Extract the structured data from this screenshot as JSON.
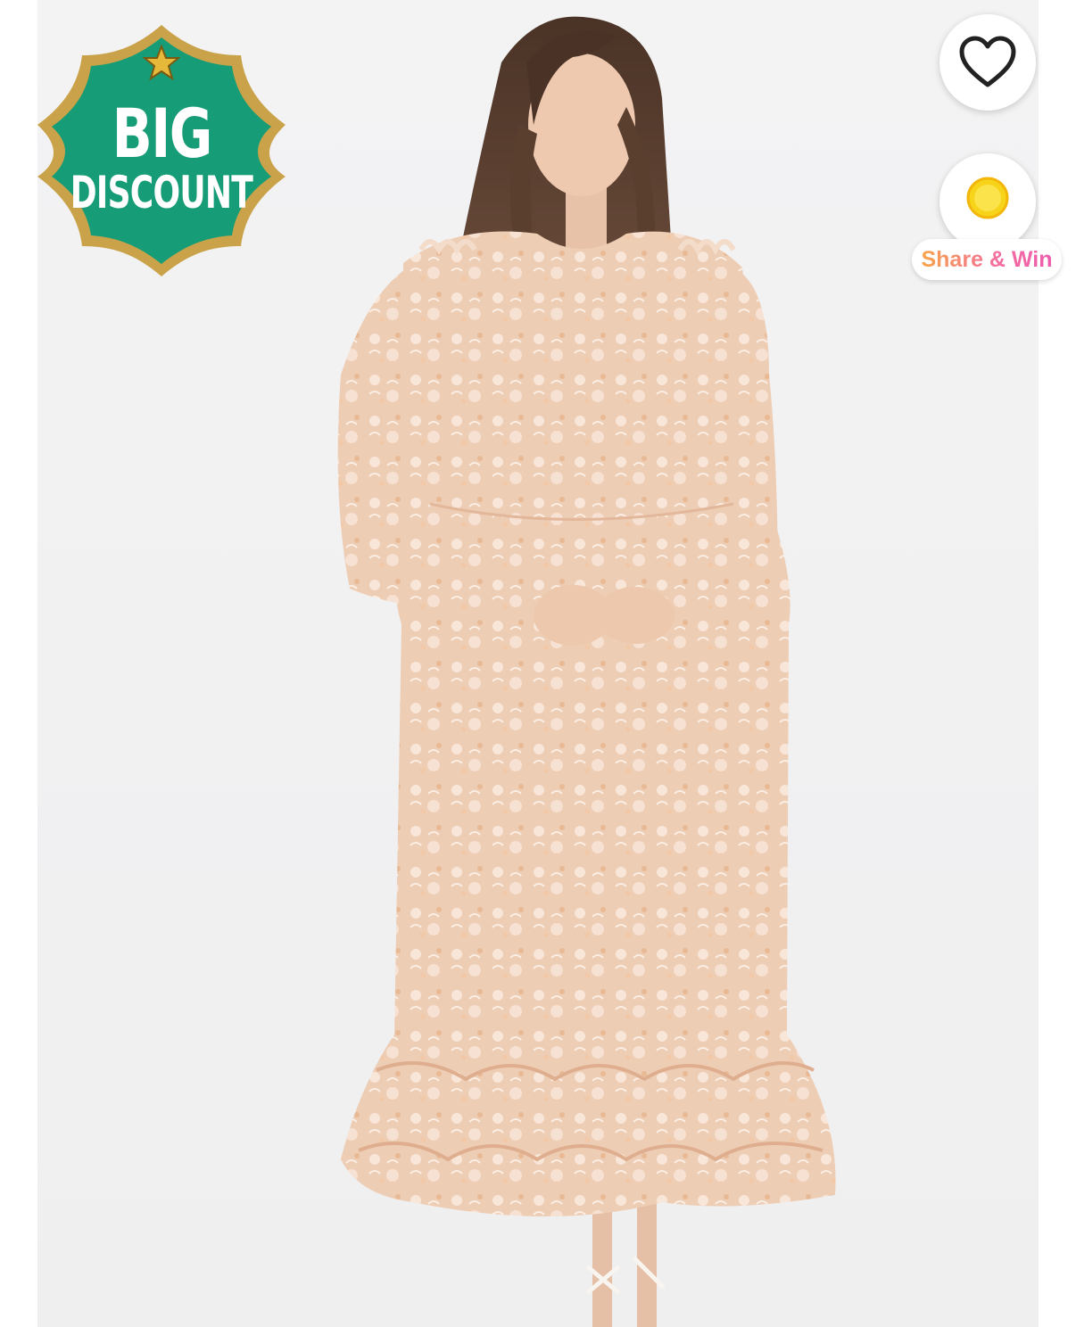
{
  "badge": {
    "line1": "BIG",
    "line2": "DISCOUNT",
    "bg_color": "#169c76",
    "border_color": "#c9a24a",
    "star_icon": "star-icon"
  },
  "favorite": {
    "icon": "heart-outline-icon"
  },
  "share": {
    "icon": "gold-coin-icon",
    "label": "Share & Win"
  },
  "product_image": {
    "alt": ""
  }
}
